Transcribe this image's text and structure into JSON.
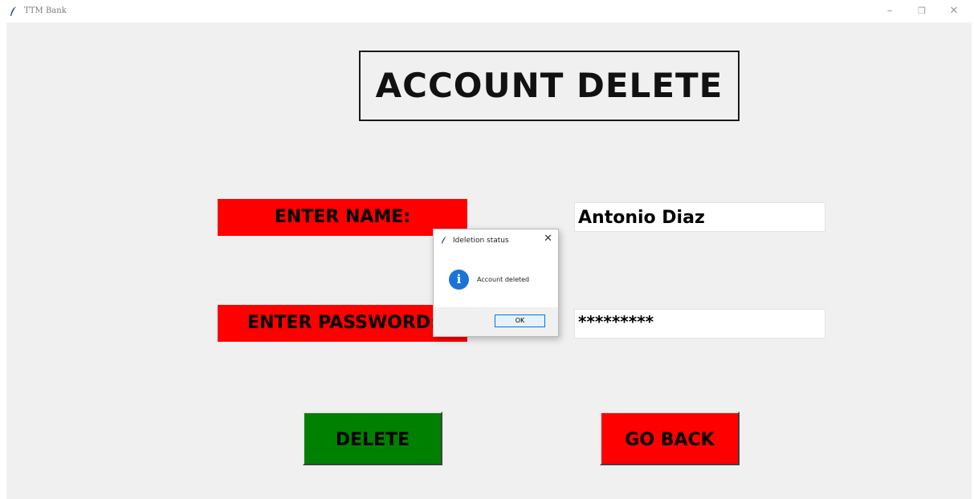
{
  "window": {
    "title": "TTM Bank",
    "icon": "feather-icon",
    "controls": {
      "minimize": "–",
      "restore": "❐",
      "close": "✕"
    }
  },
  "main": {
    "heading": "ACCOUNT DELETE",
    "name_label": "ENTER NAME:",
    "name_value": "Antonio Diaz",
    "password_label": "ENTER PASSWORD:",
    "password_value": "*********",
    "delete_button": "DELETE",
    "back_button": "GO BACK"
  },
  "dialog": {
    "title": "Ideletion status",
    "icon": "info-icon",
    "info_glyph": "i",
    "message": "Account deleted",
    "ok_label": "OK",
    "close_glyph": "✕"
  },
  "colors": {
    "label_bg": "#ff0000",
    "delete_bg": "#008000",
    "back_bg": "#ff0000",
    "info_blue": "#1a73d9"
  }
}
